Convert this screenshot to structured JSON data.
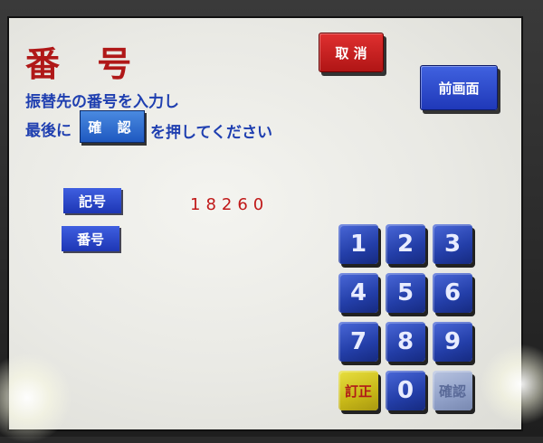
{
  "title": "番 号",
  "instruction": {
    "line1": "振替先の番号を入力し",
    "line2_prefix": "最後に",
    "line2_button": "確 認",
    "line2_suffix": "を押してください"
  },
  "buttons": {
    "cancel": "取 消",
    "previous_screen": "前画面"
  },
  "fields": {
    "symbol_label": "記号",
    "symbol_value": "18260",
    "number_label": "番号",
    "number_value": ""
  },
  "keypad": {
    "k1": "1",
    "k2": "2",
    "k3": "3",
    "k4": "4",
    "k5": "5",
    "k6": "6",
    "k7": "7",
    "k8": "8",
    "k9": "9",
    "correct": "訂正",
    "k0": "0",
    "confirm": "確認"
  },
  "colors": {
    "title": "#b01818",
    "instruction_text": "#1f3fb0",
    "key_blue": "#233ea8",
    "cancel_red": "#c81c1c",
    "correct_yellow": "#d8c820"
  }
}
